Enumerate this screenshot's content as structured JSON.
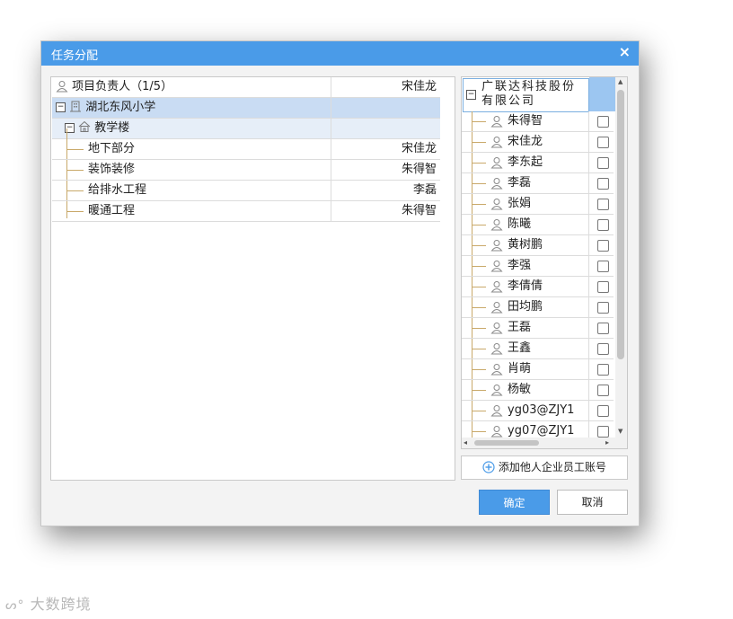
{
  "dialog": {
    "title": "任务分配",
    "close_symbol": "×",
    "confirm_label": "确定",
    "cancel_label": "取消",
    "add_account_label": "添加他人企业员工账号",
    "accent_color": "#4a9be8"
  },
  "left_table": {
    "header": {
      "label": "项目负责人（1/5）",
      "owner": "宋佳龙"
    },
    "rows": [
      {
        "name": "湖北东风小学",
        "owner": "",
        "icon": "building-icon"
      },
      {
        "name": "教学楼",
        "owner": "",
        "icon": "house-icon"
      },
      {
        "name": "地下部分",
        "owner": "宋佳龙"
      },
      {
        "name": "装饰装修",
        "owner": "朱得智"
      },
      {
        "name": "给排水工程",
        "owner": "李磊"
      },
      {
        "name": "暖通工程",
        "owner": "朱得智"
      }
    ]
  },
  "right_tree": {
    "root": "广联达科技股份有限公司",
    "members": [
      "朱得智",
      "宋佳龙",
      "李东起",
      "李磊",
      "张娟",
      "陈曦",
      "黄树鹏",
      "李强",
      "李倩倩",
      "田均鹏",
      "王磊",
      "王鑫",
      "肖萌",
      "杨敏",
      "yg03@ZJY1",
      "yg07@ZJY1"
    ]
  },
  "watermark": "大数跨境"
}
